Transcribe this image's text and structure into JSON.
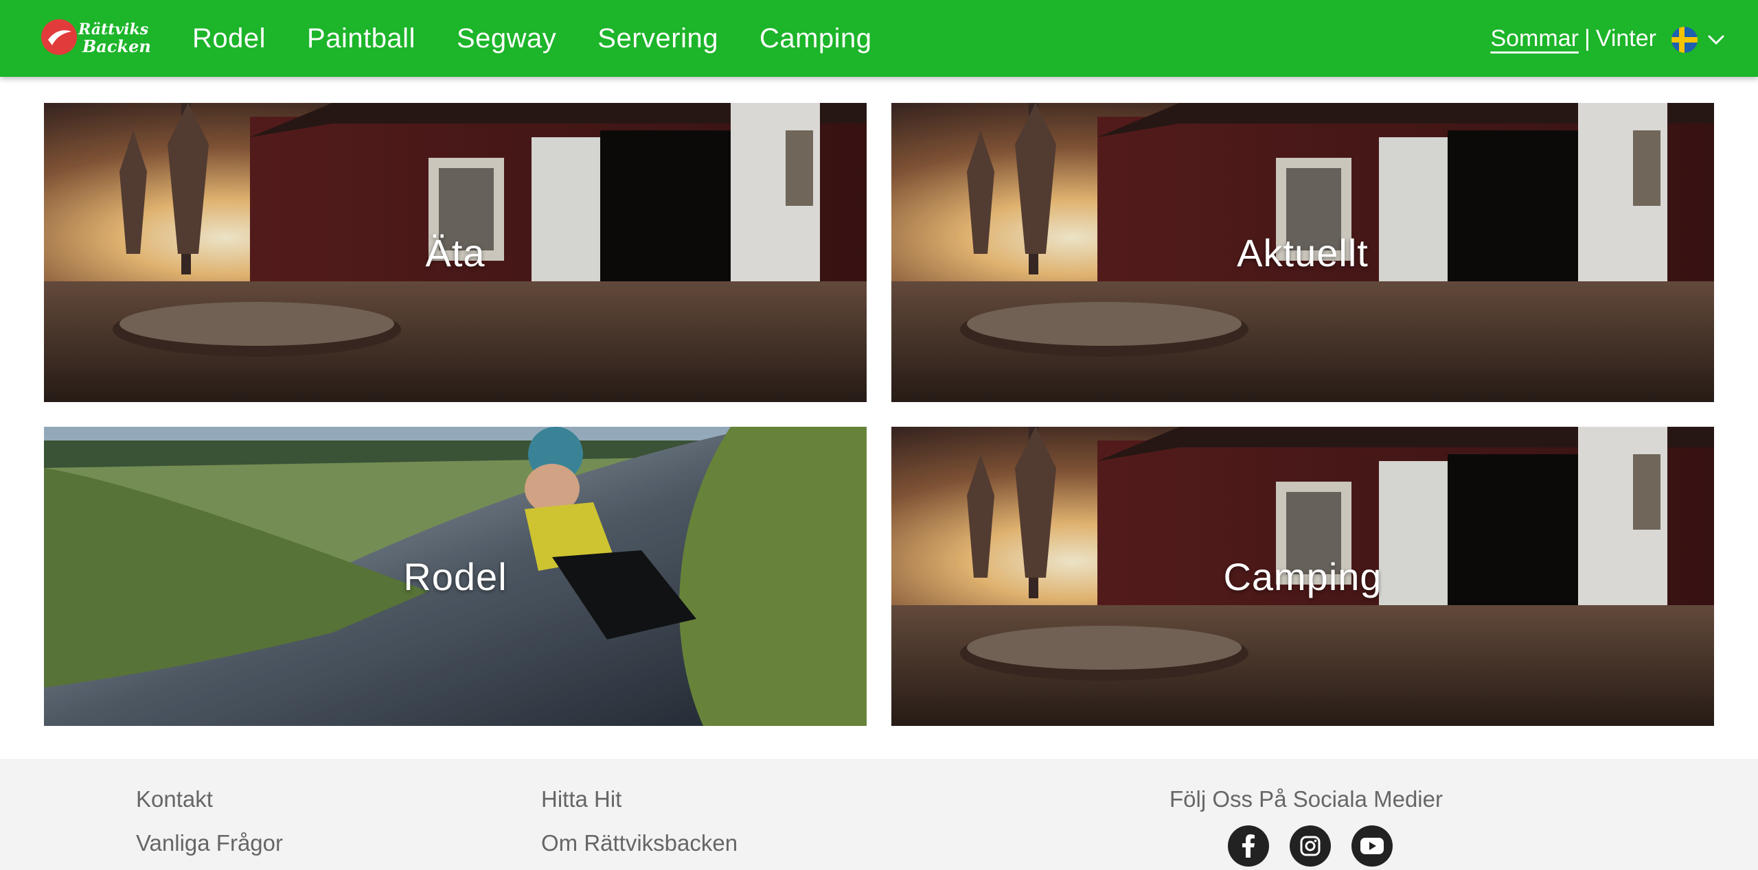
{
  "header": {
    "brand_name": "Rättviks Backen",
    "nav": [
      "Rodel",
      "Paintball",
      "Segway",
      "Servering",
      "Camping"
    ],
    "season": {
      "active": "Sommar",
      "separator": "|",
      "other": "Vinter"
    },
    "language_icon": "swedish-flag-icon",
    "accent_color": "#1db52a"
  },
  "tiles": [
    {
      "label": "Äta",
      "image": "terrace-sunset"
    },
    {
      "label": "Aktuellt",
      "image": "terrace-sunset"
    },
    {
      "label": "Rodel",
      "image": "kid-on-toboggan"
    },
    {
      "label": "Camping",
      "image": "terrace-sunset"
    }
  ],
  "footer": {
    "col1": [
      "Kontakt",
      "Vanliga Frågor"
    ],
    "col2": [
      "Hitta Hit",
      "Om Rättviksbacken"
    ],
    "social_title": "Följ Oss På Sociala Medier",
    "social": [
      "facebook-icon",
      "instagram-icon",
      "youtube-icon"
    ]
  }
}
